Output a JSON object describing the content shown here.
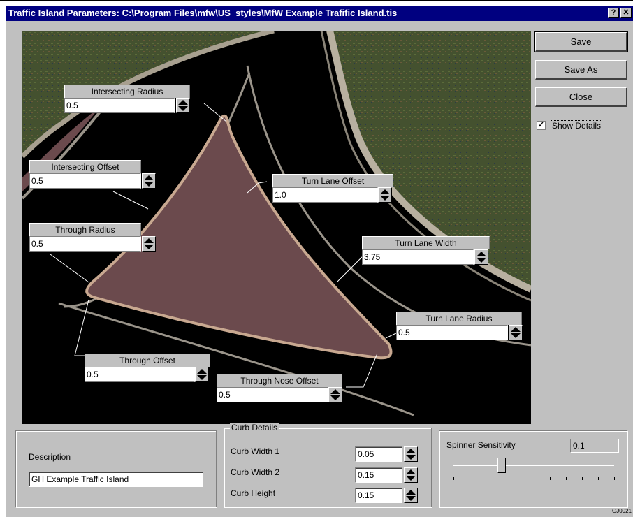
{
  "window": {
    "title": "Traffic Island Parameters: C:\\Program Files\\mfw\\US_styles\\MfW Example Trafific Island.tis",
    "help_label": "?",
    "close_label": "✕"
  },
  "params": {
    "intersecting_radius": {
      "label": "Intersecting Radius",
      "value": "0.5"
    },
    "intersecting_offset": {
      "label": "Intersecting Offset",
      "value": "0.5"
    },
    "through_radius": {
      "label": "Through Radius",
      "value": "0.5"
    },
    "through_offset": {
      "label": "Through Offset",
      "value": "0.5"
    },
    "through_nose_offset": {
      "label": "Through Nose Offset",
      "value": "0.5"
    },
    "turn_lane_offset": {
      "label": "Turn Lane Offset",
      "value": "1.0"
    },
    "turn_lane_width": {
      "label": "Turn Lane Width",
      "value": "3.75"
    },
    "turn_lane_radius": {
      "label": "Turn Lane Radius",
      "value": "0.5"
    }
  },
  "buttons": {
    "save": "Save",
    "save_as": "Save As",
    "close": "Close"
  },
  "show_details": {
    "label": "Show Details",
    "checked": true,
    "mark": "✓"
  },
  "description": {
    "label": "Description",
    "value": "GH Example Traffic Island"
  },
  "curb": {
    "title": "Curb Details",
    "width1": {
      "label": "Curb Width 1",
      "value": "0.05"
    },
    "width2": {
      "label": "Curb Width 2",
      "value": "0.15"
    },
    "height": {
      "label": "Curb Height",
      "value": "0.15"
    }
  },
  "spinner": {
    "label": "Spinner Sensitivity",
    "value": "0.1",
    "slider_position": 0.3
  },
  "corner_code": "GJ0021",
  "colors": {
    "title_bg": "#000080",
    "island": "#6b4a4d",
    "window": "#c0c0c0"
  }
}
